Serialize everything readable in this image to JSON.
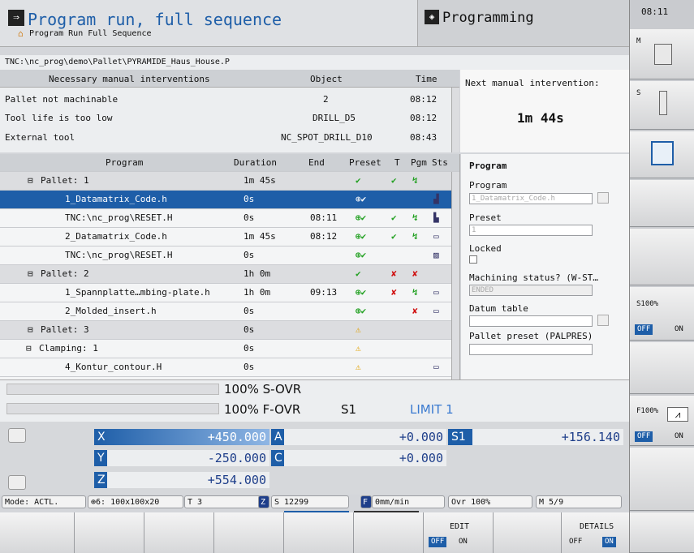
{
  "header": {
    "title": "Program run, full sequence",
    "subtitle": "Program Run Full Sequence",
    "mode2": "Programming",
    "clock": "08:11"
  },
  "path": "TNC:\\nc_prog\\demo\\Pallet\\PYRAMIDE_Haus_House.P",
  "interventions": {
    "headers": [
      "Necessary manual interventions",
      "Object",
      "Time"
    ],
    "rows": [
      [
        "Pallet not machinable",
        "2",
        "08:12"
      ],
      [
        "Tool life is too low",
        "DRILL_D5",
        "08:12"
      ],
      [
        "External tool",
        "NC_SPOT_DRILL_D10",
        "08:43"
      ]
    ],
    "next_label": "Next manual intervention:",
    "next_value": "1m 44s"
  },
  "table": {
    "headers": [
      "Program",
      "Duration",
      "End",
      "Preset",
      "T",
      "Pgm",
      "Sts"
    ],
    "rows": [
      {
        "prog": "Pallet: 1",
        "dur": "1m 45s",
        "end": "",
        "pre": "✔",
        "t": "✔",
        "pgm": "↯",
        "sts": ""
      },
      {
        "prog": "1_Datamatrix_Code.h",
        "dur": "0s",
        "end": "",
        "pre": "⊕✔",
        "t": "",
        "pgm": "",
        "sts": "▟"
      },
      {
        "prog": "TNC:\\nc_prog\\RESET.H",
        "dur": "0s",
        "end": "08:11",
        "pre": "⊕✔",
        "t": "✔",
        "pgm": "↯",
        "sts": "▙"
      },
      {
        "prog": "2_Datamatrix_Code.h",
        "dur": "1m 45s",
        "end": "08:12",
        "pre": "⊕✔",
        "t": "✔",
        "pgm": "↯",
        "sts": "▭"
      },
      {
        "prog": "TNC:\\nc_prog\\RESET.H",
        "dur": "0s",
        "end": "",
        "pre": "⊕✔",
        "t": "",
        "pgm": "",
        "sts": "▨"
      },
      {
        "prog": "Pallet: 2",
        "dur": "1h 0m",
        "end": "",
        "pre": "✔",
        "t": "✘",
        "pgm": "✘",
        "sts": ""
      },
      {
        "prog": "1_Spannplatte…mbing-plate.h",
        "dur": "1h 0m",
        "end": "09:13",
        "pre": "⊕✔",
        "t": "✘",
        "pgm": "↯",
        "sts": "▭"
      },
      {
        "prog": "2_Molded_insert.h",
        "dur": "0s",
        "end": "",
        "pre": "⊕✔",
        "t": "",
        "pgm": "✘",
        "sts": "▭"
      },
      {
        "prog": "Pallet: 3",
        "dur": "0s",
        "end": "",
        "pre": "⚠",
        "t": "",
        "pgm": "",
        "sts": ""
      },
      {
        "prog": "Clamping: 1",
        "dur": "0s",
        "end": "",
        "pre": "⚠",
        "t": "",
        "pgm": "",
        "sts": ""
      },
      {
        "prog": "4_Kontur_contour.H",
        "dur": "0s",
        "end": "",
        "pre": "⚠",
        "t": "",
        "pgm": "",
        "sts": "▭"
      }
    ]
  },
  "details": {
    "title": "Program",
    "program_label": "Program",
    "program_value": "1_Datamatrix_Code.h",
    "preset_label": "Preset",
    "preset_value": "1",
    "locked_label": "Locked",
    "status_label": "Machining status? (W-ST…",
    "status_value": "ENDED",
    "datum_label": "Datum table",
    "palpres_label": "Pallet preset (PALPRES)"
  },
  "override": {
    "s": "100% S-OVR",
    "f": "100% F-OVR",
    "s1": "S1",
    "limit": "LIMIT 1"
  },
  "axes": {
    "x_l": "X",
    "x": "+450.000",
    "y_l": "Y",
    "y": "-250.000",
    "z_l": "Z",
    "z": "+554.000",
    "a_l": "A",
    "a": "+0.000",
    "c_l": "C",
    "c": "+0.000",
    "s_l": "S1",
    "s": "+156.140"
  },
  "status": {
    "mode": "Mode: ACTL.",
    "preset": "⊕6: 100x100x20",
    "t": "T 3",
    "z": "Z",
    "s": "S 12299",
    "f": "F",
    "feed": "0mm/min",
    "ovr": "Ovr 100%",
    "m": "M 5/9"
  },
  "softkeys": {
    "edit": "EDIT",
    "details": "DETAILS",
    "off": "OFF",
    "on": "ON"
  },
  "right": {
    "m": "M",
    "s": "S",
    "s100": "S100%",
    "f100": "F100%",
    "off": "OFF",
    "on": "ON"
  }
}
